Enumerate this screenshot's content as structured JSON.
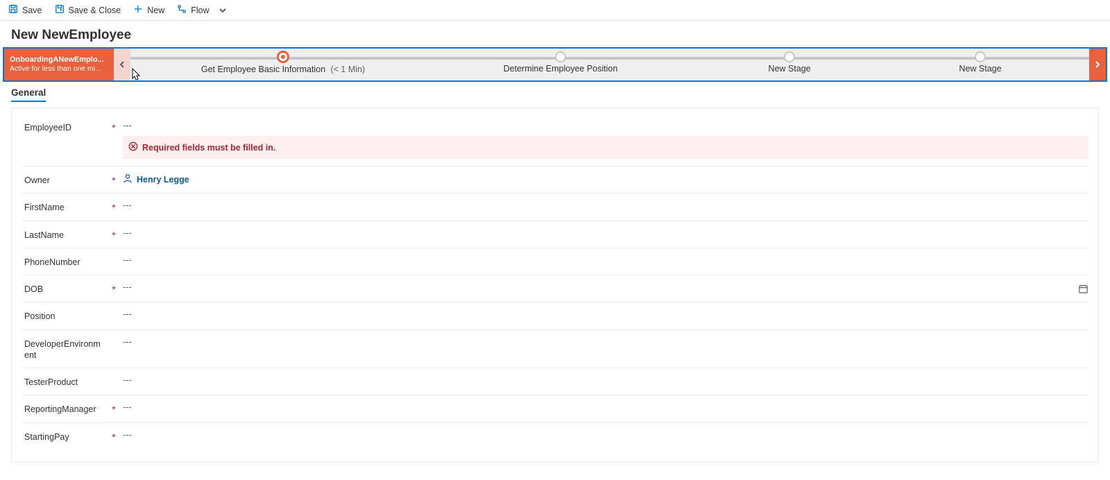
{
  "commandBar": {
    "save": "Save",
    "saveClose": "Save & Close",
    "new": "New",
    "flow": "Flow"
  },
  "pageTitle": "New NewEmployee",
  "bpf": {
    "processName": "OnboardingANewEmplo...",
    "processStatus": "Active for less than one mi...",
    "stages": [
      {
        "label": "Get Employee Basic Information",
        "sub": "(< 1 Min)",
        "active": true
      },
      {
        "label": "Determine Employee Position",
        "sub": "",
        "active": false
      },
      {
        "label": "New Stage",
        "sub": "",
        "active": false
      },
      {
        "label": "New Stage",
        "sub": "",
        "active": false
      }
    ]
  },
  "tabs": {
    "general": "General"
  },
  "validation": {
    "requiredMsg": "Required fields must be filled in."
  },
  "owner": {
    "name": "Henry Legge"
  },
  "placeholder": "---",
  "fields": {
    "employeeId": {
      "label": "EmployeeID",
      "required": true
    },
    "owner": {
      "label": "Owner",
      "required": true
    },
    "firstName": {
      "label": "FirstName",
      "required": true
    },
    "lastName": {
      "label": "LastName",
      "required": true
    },
    "phone": {
      "label": "PhoneNumber",
      "required": false
    },
    "dob": {
      "label": "DOB",
      "required": true
    },
    "position": {
      "label": "Position",
      "required": false
    },
    "devEnv": {
      "label": "DeveloperEnvironment",
      "required": false
    },
    "tester": {
      "label": "TesterProduct",
      "required": false
    },
    "manager": {
      "label": "ReportingManager",
      "required": true
    },
    "pay": {
      "label": "StartingPay",
      "required": true
    }
  }
}
